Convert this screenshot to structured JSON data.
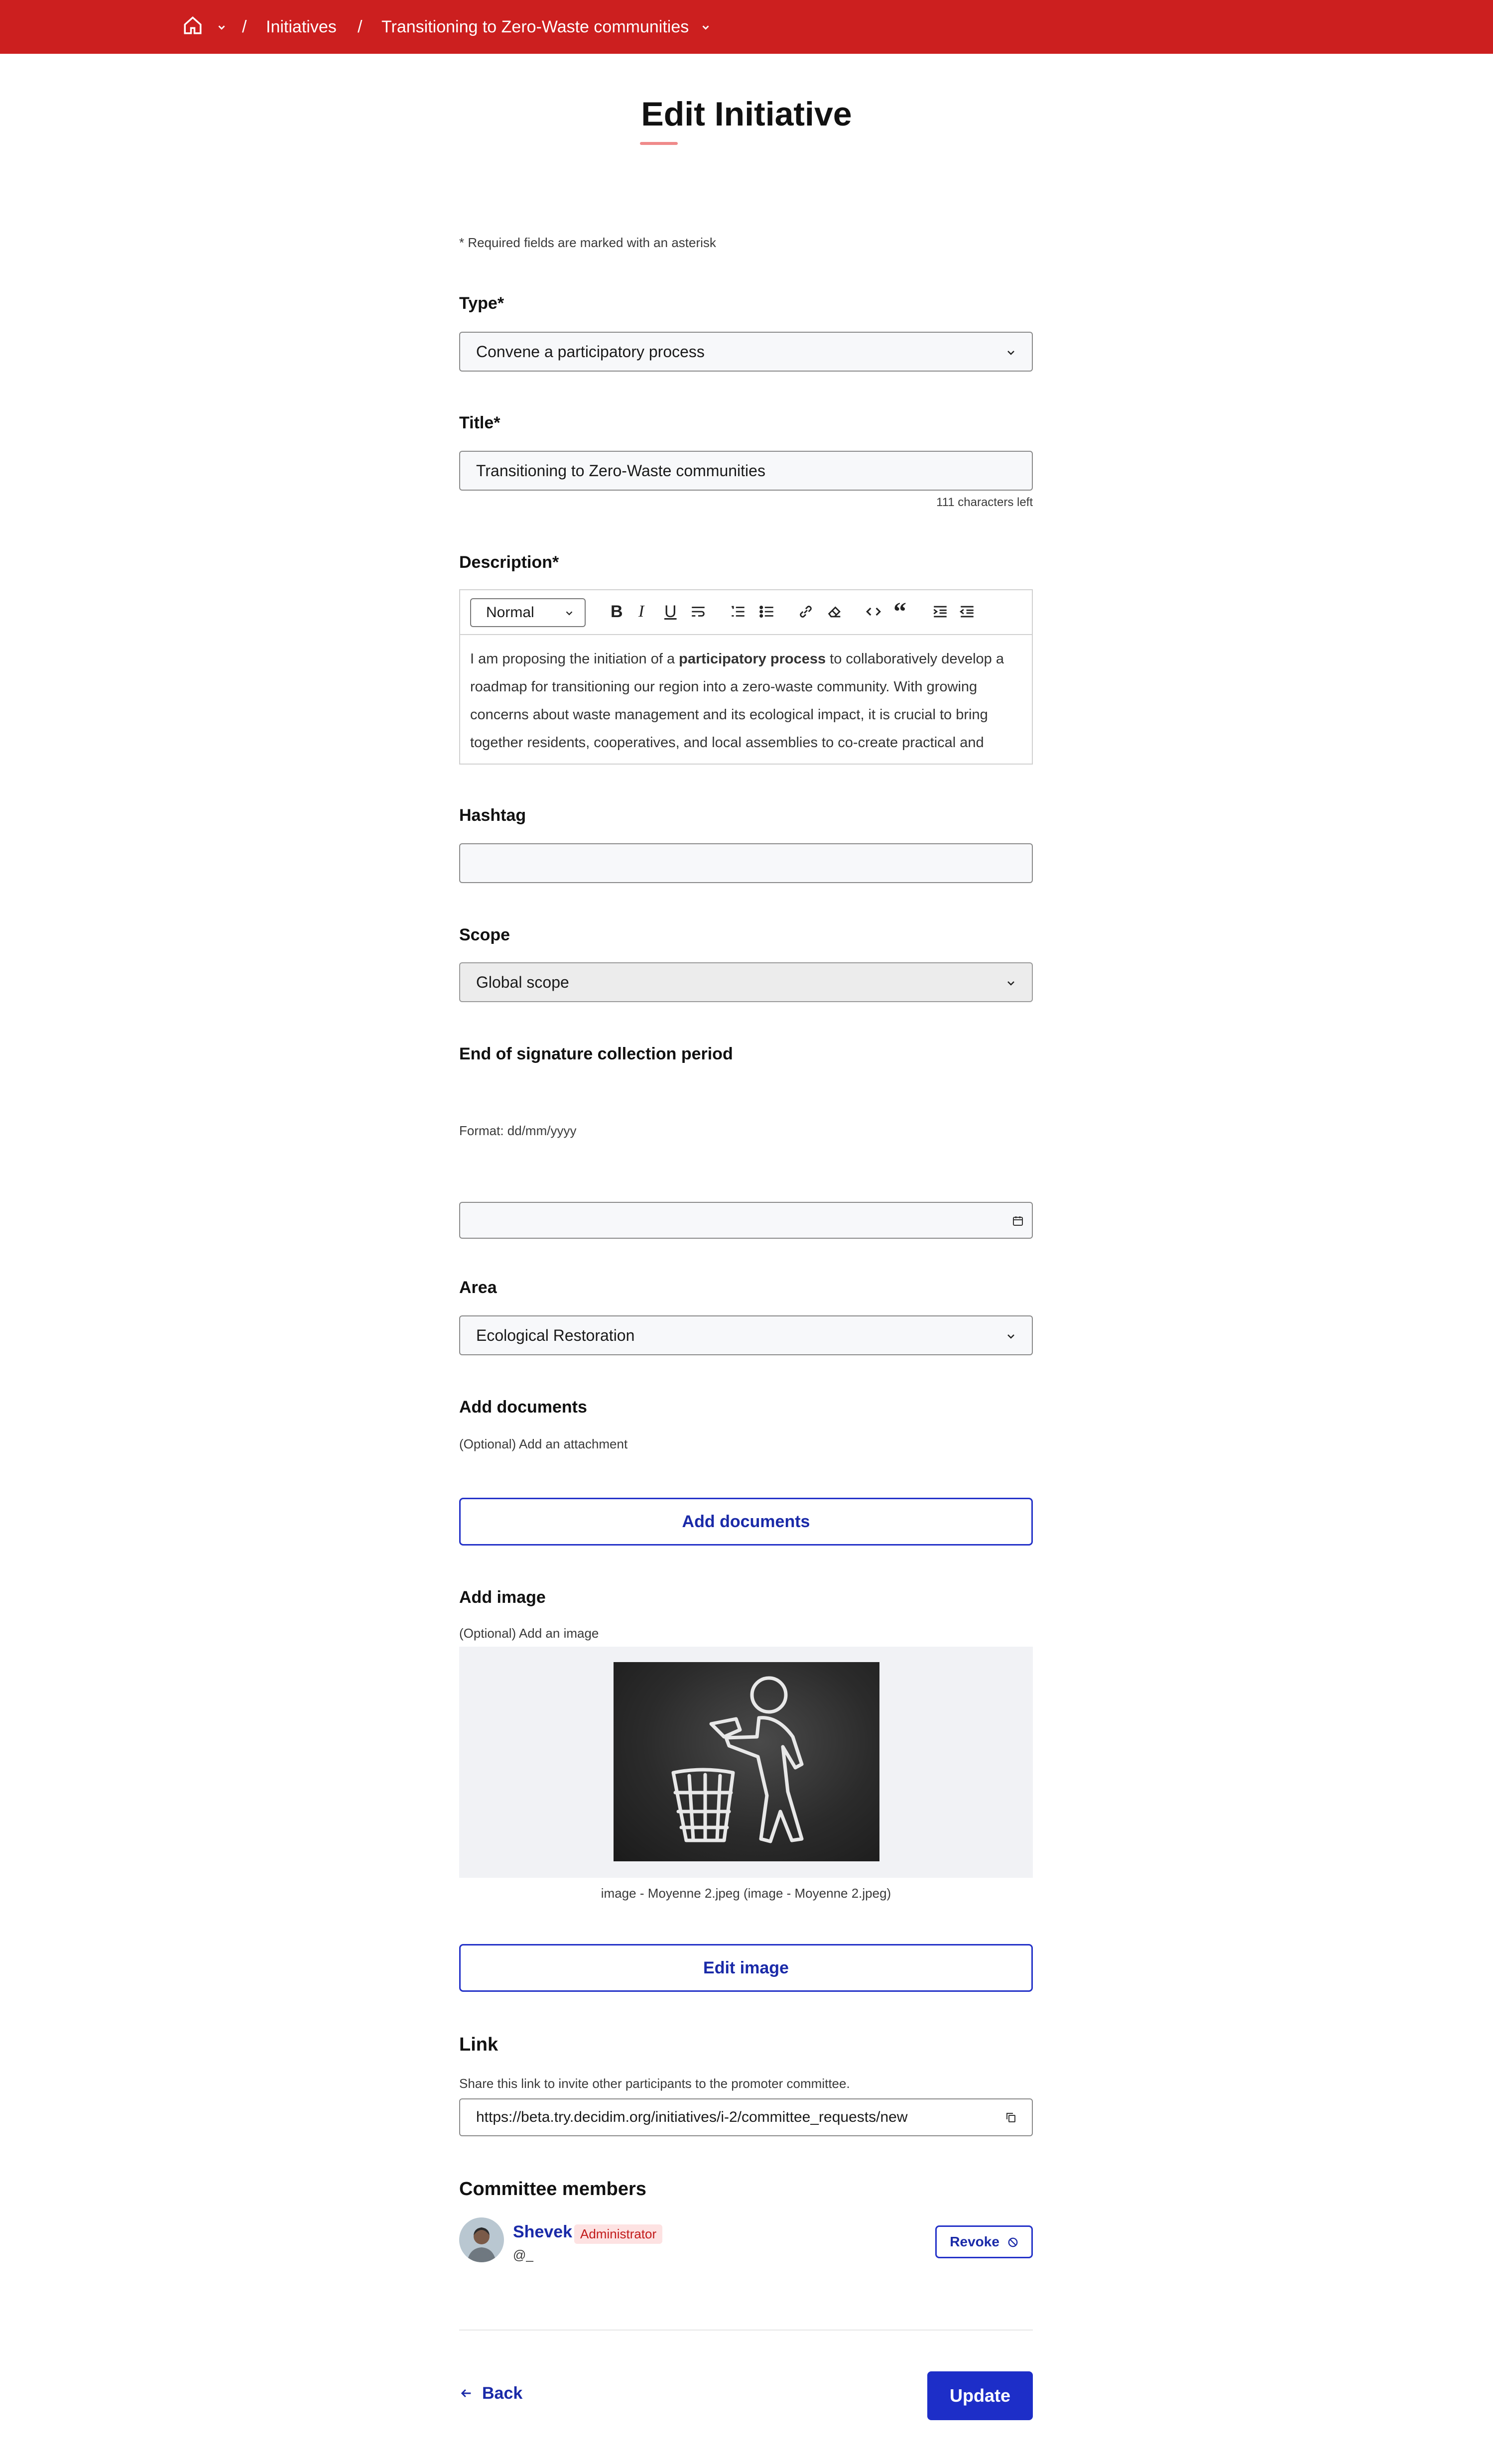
{
  "breadcrumb": {
    "home_icon": "home-icon",
    "separator": "/",
    "initiatives": "Initiatives",
    "current": "Transitioning to Zero-Waste communities"
  },
  "page": {
    "title": "Edit Initiative",
    "required_note": "* Required fields are marked with an asterisk"
  },
  "form": {
    "type": {
      "label": "Type*",
      "value": "Convene a participatory process"
    },
    "title": {
      "label": "Title*",
      "value": "Transitioning to Zero-Waste communities",
      "counter": "111 characters left"
    },
    "description": {
      "label": "Description*",
      "format": "Normal",
      "text_before": "I am proposing the initiation of a ",
      "text_bold": "participatory process",
      "text_after": " to collaboratively develop a roadmap for transitioning our region into a zero-waste community. With growing concerns about waste management and its ecological impact, it is crucial to bring together residents, cooperatives, and local assemblies to co-create practical and"
    },
    "hashtag": {
      "label": "Hashtag",
      "value": ""
    },
    "scope": {
      "label": "Scope",
      "value": "Global scope"
    },
    "signature_end": {
      "label": "End of signature collection period",
      "format_hint": "Format: dd/mm/yyyy",
      "value": ""
    },
    "area": {
      "label": "Area",
      "value": "Ecological Restoration"
    },
    "documents": {
      "label": "Add documents",
      "hint": "(Optional) Add an attachment",
      "button": "Add documents"
    },
    "image": {
      "label": "Add image",
      "hint": "(Optional) Add an image",
      "caption": "image - Moyenne 2.jpeg (image - Moyenne 2.jpeg)",
      "button": "Edit image"
    },
    "link": {
      "label": "Link",
      "hint": "Share this link to invite other participants to the promoter committee.",
      "value": "https://beta.try.decidim.org/initiatives/i-2/committee_requests/new"
    },
    "committee": {
      "label": "Committee members",
      "members": [
        {
          "name": "Shevek",
          "role": "Administrator",
          "nickname": "@_",
          "action": "Revoke"
        }
      ]
    }
  },
  "footer": {
    "back": "Back",
    "update": "Update"
  },
  "colors": {
    "topbar": "#cc1f1f",
    "primary": "#1d2ec8",
    "badge_bg": "#fde2e2",
    "badge_text": "#c21a1a"
  }
}
